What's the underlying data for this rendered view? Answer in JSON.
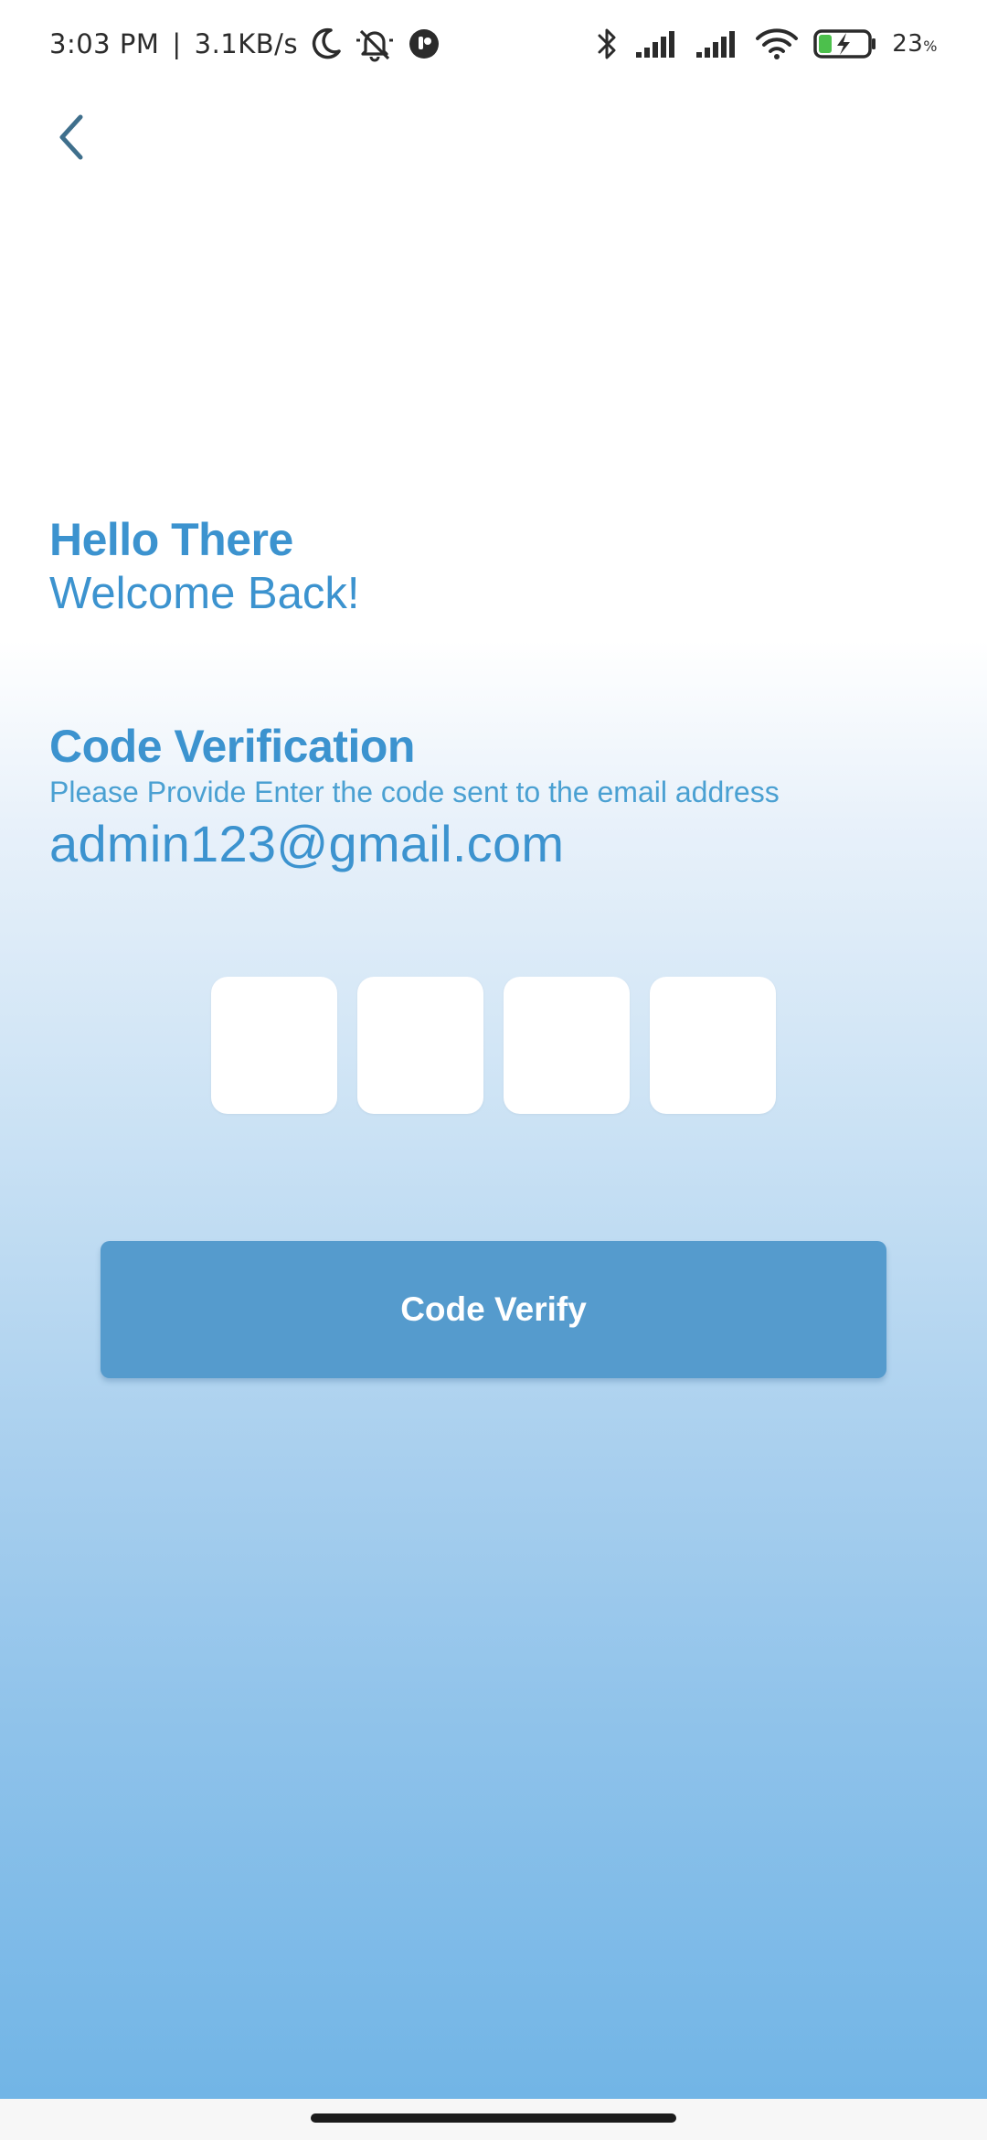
{
  "status_bar": {
    "time": "3:03 PM",
    "network_speed": "3.1KB/s",
    "battery_percent": "23",
    "battery_percent_sign": "%",
    "icons": [
      "moon-icon",
      "alarm-off-icon",
      "app-notification-icon",
      "bluetooth-icon",
      "signal-icon",
      "signal-icon",
      "wifi-icon",
      "battery-charging-icon"
    ]
  },
  "header": {
    "back_icon": "chevron-left-icon"
  },
  "greeting": {
    "hello": "Hello There",
    "welcome": "Welcome Back!"
  },
  "verification": {
    "title": "Code Verification",
    "description": "Please Provide Enter the code sent to the email address",
    "email": "admin123@gmail.com"
  },
  "otp": {
    "digits": [
      "",
      "",
      "",
      ""
    ]
  },
  "actions": {
    "verify_label": "Code Verify"
  },
  "colors": {
    "accent": "#3c93cf",
    "button": "#559bcd",
    "gradient_bottom": "#72b5e6"
  }
}
